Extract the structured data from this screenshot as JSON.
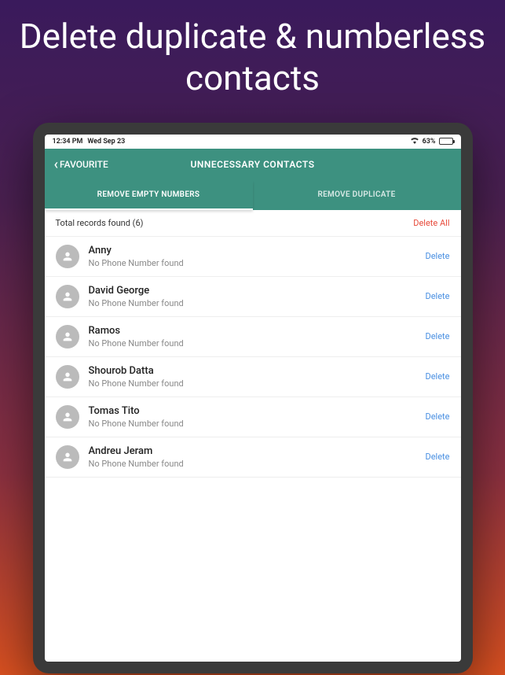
{
  "marketing": {
    "headline": "Delete duplicate & numberless contacts"
  },
  "statusBar": {
    "time": "12:34 PM",
    "date": "Wed Sep 23",
    "battery": "63%"
  },
  "nav": {
    "back": "FAVOURITE",
    "title": "UNNECESSARY CONTACTS"
  },
  "tabs": {
    "active": "REMOVE EMPTY NUMBERS",
    "inactive": "REMOVE DUPLICATE"
  },
  "summary": {
    "total": "Total records found (6)",
    "deleteAll": "Delete All"
  },
  "contacts": [
    {
      "name": "Anny",
      "sub": "No Phone Number found",
      "action": "Delete"
    },
    {
      "name": "David George",
      "sub": "No Phone Number found",
      "action": "Delete"
    },
    {
      "name": "Ramos",
      "sub": "No Phone Number found",
      "action": "Delete"
    },
    {
      "name": "Shourob Datta",
      "sub": "No Phone Number found",
      "action": "Delete"
    },
    {
      "name": "Tomas Tito",
      "sub": "No Phone Number found",
      "action": "Delete"
    },
    {
      "name": "Andreu Jeram",
      "sub": "No Phone Number found",
      "action": "Delete"
    }
  ]
}
